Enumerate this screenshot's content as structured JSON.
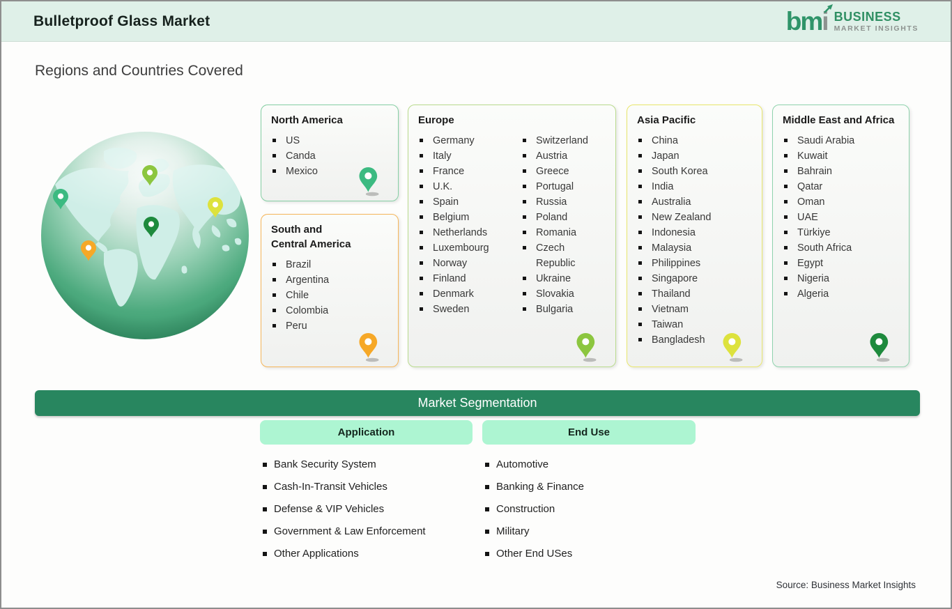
{
  "header": {
    "title": "Bulletproof Glass Market",
    "logo": {
      "mark_bm": "bm",
      "mark_i": "i",
      "line1": "BUSINESS",
      "line2": "MARKET INSIGHTS"
    }
  },
  "section_title": "Regions and Countries Covered",
  "regions": [
    {
      "name": "North America",
      "pin_color": "#3cba81",
      "border_color": "#86cfa4",
      "columns": [
        [
          "US",
          "Canda",
          "Mexico"
        ]
      ]
    },
    {
      "name": "South and Central America",
      "pin_color": "#f6a827",
      "border_color": "#f5b65b",
      "columns": [
        [
          "Brazil",
          "Argentina",
          "Chile",
          "Colombia",
          "Peru"
        ]
      ]
    },
    {
      "name": "Europe",
      "pin_color": "#8cc63f",
      "border_color": "#b9db8d",
      "columns": [
        [
          "Germany",
          "Italy",
          "France",
          "U.K.",
          "Spain",
          "Belgium",
          "Netherlands",
          "Luxembourg",
          "Norway",
          "Finland",
          "Denmark",
          "Sweden"
        ],
        [
          "Switzerland",
          "Austria",
          "Greece",
          "Portugal",
          "Russia",
          "Poland",
          "Romania",
          "Czech Republic",
          "Ukraine",
          "Slovakia",
          "Bulgaria"
        ]
      ]
    },
    {
      "name": "Asia Pacific",
      "pin_color": "#dde23d",
      "border_color": "#e9e76b",
      "columns": [
        [
          "China",
          "Japan",
          "South Korea",
          "India",
          "Australia",
          "New Zealand",
          "Indonesia",
          "Malaysia",
          "Philippines",
          "Singapore",
          "Thailand",
          "Vietnam",
          "Taiwan",
          "Bangladesh"
        ]
      ]
    },
    {
      "name": "Middle East and Africa",
      "pin_color": "#1e8a3d",
      "border_color": "#8fd3ad",
      "columns": [
        [
          "Saudi Arabia",
          "Kuwait",
          "Bahrain",
          "Qatar",
          "Oman",
          "UAE",
          "Türkiye",
          "South Africa",
          "Egypt",
          "Nigeria",
          "Algeria"
        ]
      ]
    }
  ],
  "segmentation": {
    "title": "Market Segmentation",
    "groups": [
      {
        "label": "Application",
        "items": [
          "Bank Security System",
          "Cash-In-Transit Vehicles",
          "Defense & VIP Vehicles",
          "Government & Law Enforcement",
          "Other Applications"
        ]
      },
      {
        "label": "End Use",
        "items": [
          "Automotive",
          "Banking & Finance",
          "Construction",
          "Military",
          "Other End USes"
        ]
      }
    ]
  },
  "source": "Source: Business Market Insights",
  "colors": {
    "header_bg": "#dff0e8",
    "brand_green": "#2f9469",
    "segment_bar_bg": "#28865f",
    "pill_bg": "#adf5d2",
    "globe_ocean": "#2f8f63",
    "globe_land": "#cfeee7"
  }
}
